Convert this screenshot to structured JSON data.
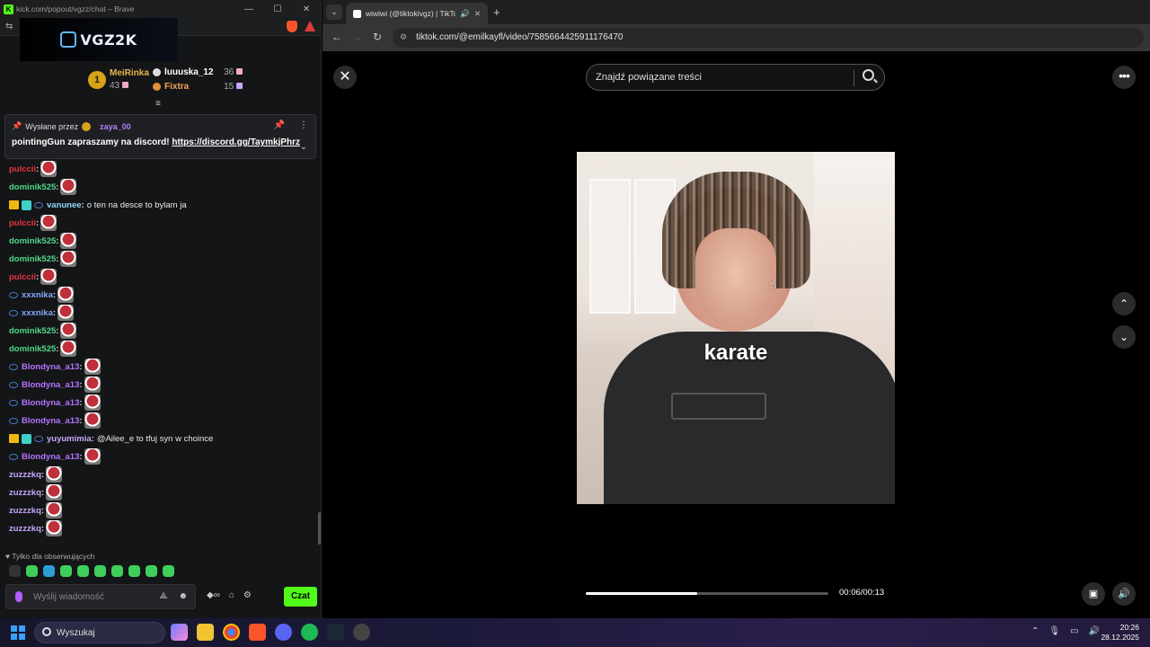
{
  "kick": {
    "window_title": "kick.com/popout/vgzz/chat – Brave",
    "logo_letter": "K",
    "banner_text": "VGZ2K",
    "leaderboard": {
      "first": {
        "rank": "1",
        "name": "MeiRinka",
        "count": "43"
      },
      "second": {
        "name": "luuuska_12",
        "count": "36"
      },
      "third": {
        "name": "Fixtra",
        "count": "15"
      }
    },
    "pinned": {
      "sent_by_label": "Wysłane przez",
      "user": "zaya_00",
      "message_prefix": "pointingGun zapraszamy na discord!",
      "link": "https://discord.gg/TaymkjPhrz"
    },
    "messages": [
      {
        "user": "pulccii",
        "color": "red",
        "text": ""
      },
      {
        "user": "dominik525",
        "color": "green",
        "text": ""
      },
      {
        "user": "vanunee",
        "color": "teal",
        "text": "o ten na desce to bylam ja",
        "badges": true
      },
      {
        "user": "pulccii",
        "color": "red",
        "text": ""
      },
      {
        "user": "dominik525",
        "color": "green",
        "text": ""
      },
      {
        "user": "dominik525",
        "color": "green",
        "text": ""
      },
      {
        "user": "pulccii",
        "color": "red",
        "text": ""
      },
      {
        "user": "xxxnika",
        "color": "blue",
        "text": "",
        "sub": true
      },
      {
        "user": "xxxnika",
        "color": "blue",
        "text": "",
        "sub": true
      },
      {
        "user": "dominik525",
        "color": "green",
        "text": ""
      },
      {
        "user": "dominik525",
        "color": "green",
        "text": ""
      },
      {
        "user": "Blondyna_a13",
        "color": "purple",
        "text": "",
        "sub": true
      },
      {
        "user": "Blondyna_a13",
        "color": "purple",
        "text": "",
        "sub": true
      },
      {
        "user": "Blondyna_a13",
        "color": "purple",
        "text": "",
        "sub": true
      },
      {
        "user": "Blondyna_a13",
        "color": "purple",
        "text": "",
        "sub": true
      },
      {
        "user": "yuyumimia",
        "color": "lav",
        "text": "@Ailee_e to tfuj syn w choince",
        "badges": true
      },
      {
        "user": "Blondyna_a13",
        "color": "purple",
        "text": "",
        "sub": true
      },
      {
        "user": "zuzzzkq",
        "color": "lav",
        "text": ""
      },
      {
        "user": "zuzzzkq",
        "color": "lav",
        "text": ""
      },
      {
        "user": "zuzzzkq",
        "color": "lav",
        "text": ""
      },
      {
        "user": "zuzzzkq",
        "color": "lav",
        "text": ""
      }
    ],
    "followers_only": "Tylko dla obserwujących",
    "composer_placeholder": "Wyślij wiadomość",
    "chat_button": "Czat"
  },
  "browser": {
    "tab_title": "wiwiwi (@tiktokivgz) | TikTo",
    "url": "tiktok.com/@emilkayfl/video/7585664425911176470",
    "search_placeholder": "Znajdź powiązane treści",
    "video_caption": "karate",
    "progress_fraction": 0.46,
    "time": "00:06/00:13"
  },
  "taskbar": {
    "search_label": "Wyszukaj",
    "time": "20:26",
    "date": "28.12.2025"
  },
  "colors": {
    "kick_green": "#53fc18",
    "brave_orange": "#fb542b"
  }
}
